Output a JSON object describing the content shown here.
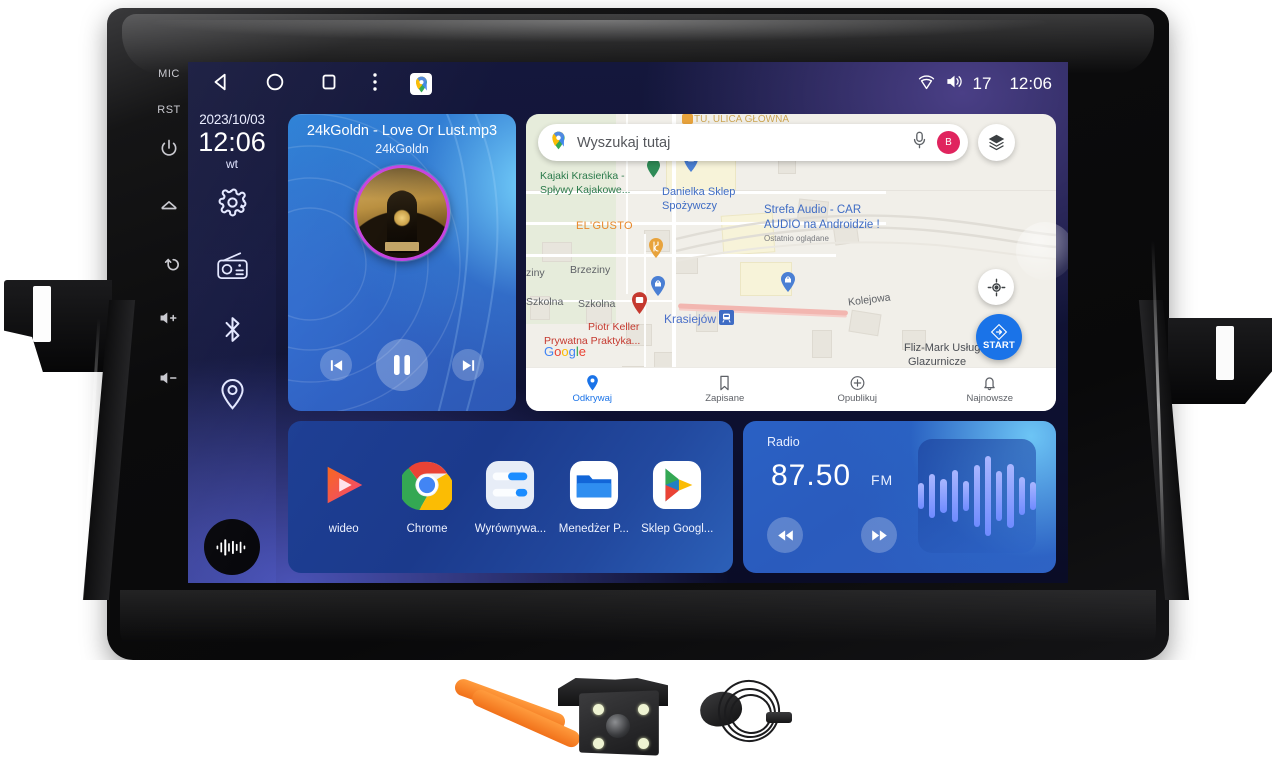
{
  "device": {
    "side_keys": [
      "MIC",
      "RST",
      "power-icon",
      "home-icon",
      "back-icon",
      "volume-up-icon",
      "volume-down-icon"
    ],
    "side_key_labels": {
      "mic": "MIC",
      "reset": "RST"
    }
  },
  "statusbar": {
    "back_icon": "back-triangle-icon",
    "home_icon": "home-circle-icon",
    "recents_icon": "recents-square-icon",
    "overflow_icon": "overflow-menu-icon",
    "app_icon": "google-maps-icon",
    "wifi_icon": "wifi-icon",
    "volume_icon": "volume-icon",
    "volume_level": "17",
    "time": "12:06"
  },
  "dock": {
    "date": "2023/10/03",
    "clock": "12:06",
    "weekday": "wt",
    "icons": [
      "settings-gear-icon",
      "radio-icon",
      "bluetooth-icon",
      "location-pin-icon"
    ],
    "wave_button": "audio-wave-icon"
  },
  "music": {
    "title": "24kGoldn - Love Or Lust.mp3",
    "artist": "24kGoldn",
    "prev_icon": "previous-track-icon",
    "play_icon": "pause-icon",
    "next_icon": "next-track-icon"
  },
  "map": {
    "search_placeholder": "Wyszukaj tutaj",
    "mic_icon": "microphone-icon",
    "avatar_initial": "B",
    "avatar_color": "#e0245e",
    "layers_icon": "map-layers-icon",
    "locate_icon": "my-location-icon",
    "start_label": "START",
    "start_color": "#1a73e8",
    "watermark": "Google",
    "top_clipped_label": "TU, ULICA GŁÓWNA",
    "labels": [
      {
        "text": "Kajaki Krasieńka -",
        "kind": "poi-green"
      },
      {
        "text": "Spływy Kajakowe...",
        "kind": "poi-green"
      },
      {
        "text": "Danielka Sklep",
        "kind": "poi-blue"
      },
      {
        "text": "Spożywczy",
        "kind": "poi-blue"
      },
      {
        "text": "Strefa Audio - CAR",
        "kind": "poi-blue"
      },
      {
        "text": "AUDIO na Androidzie !",
        "kind": "poi-blue"
      },
      {
        "text": "Ostatnio oglądane",
        "kind": "poi-sub"
      },
      {
        "text": "EL'GUSTO",
        "kind": "poi-orange"
      },
      {
        "text": "Brzeziny",
        "kind": "street"
      },
      {
        "text": "ziny",
        "kind": "street"
      },
      {
        "text": "Szkolna",
        "kind": "street"
      },
      {
        "text": "Szkolna",
        "kind": "street"
      },
      {
        "text": "Kolejowa",
        "kind": "street"
      },
      {
        "text": "Krasiejów",
        "kind": "station"
      },
      {
        "text": "Piotr Keller",
        "kind": "poi-red"
      },
      {
        "text": "Prywatna Praktyka...",
        "kind": "poi-red"
      },
      {
        "text": "Fliz-Mark Usługi",
        "kind": "poi-dark"
      },
      {
        "text": "Glazurnicze",
        "kind": "poi-dark"
      }
    ],
    "bottom_nav": [
      {
        "label": "Odkrywaj",
        "icon": "explore-pin-icon",
        "active": true
      },
      {
        "label": "Zapisane",
        "icon": "bookmark-icon",
        "active": false
      },
      {
        "label": "Opublikuj",
        "icon": "plus-circle-icon",
        "active": false
      },
      {
        "label": "Najnowsze",
        "icon": "bell-icon",
        "active": false
      }
    ]
  },
  "apps": [
    {
      "label": "wideo",
      "icon": "video-player-icon"
    },
    {
      "label": "Chrome",
      "icon": "chrome-icon"
    },
    {
      "label": "Wyrównywa...",
      "icon": "equalizer-icon"
    },
    {
      "label": "Menedżer P...",
      "icon": "file-manager-icon"
    },
    {
      "label": "Sklep Googl...",
      "icon": "google-play-icon"
    }
  ],
  "radio": {
    "title": "Radio",
    "frequency": "87.50",
    "band": "FM",
    "prev_icon": "seek-down-icon",
    "next_icon": "seek-up-icon",
    "visualizer_icon": "audio-bars-icon",
    "visualizer_bars": [
      26,
      44,
      34,
      52,
      30,
      62,
      80,
      50,
      64,
      38,
      28
    ]
  },
  "accessories": [
    {
      "name": "pry-tools",
      "color": "#f4801f"
    },
    {
      "name": "rear-view-camera",
      "color": "#222224"
    },
    {
      "name": "external-microphone",
      "color": "#1a1a1c"
    }
  ]
}
